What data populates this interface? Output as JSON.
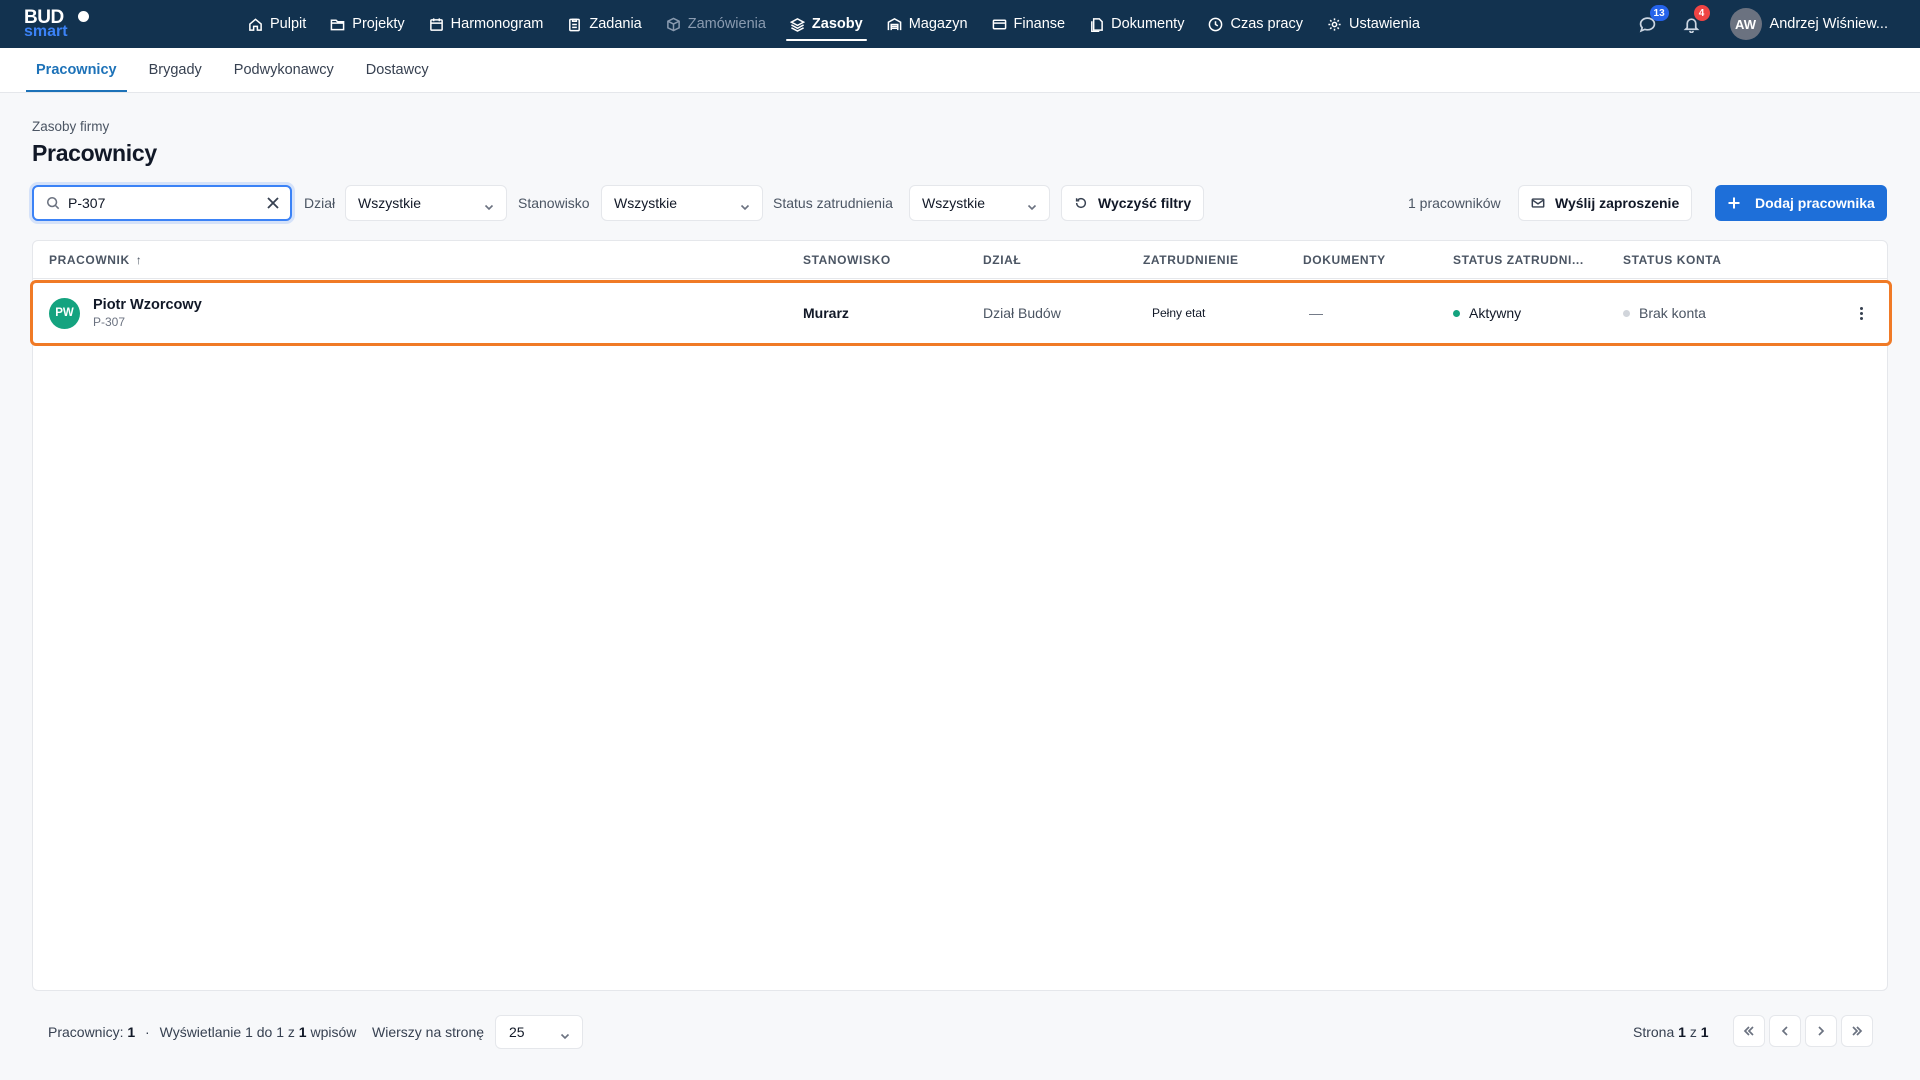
{
  "app": {
    "logo_top": "BUD",
    "logo_bottom": "smart"
  },
  "nav": {
    "items": [
      {
        "label": "Pulpit",
        "icon": "home-icon"
      },
      {
        "label": "Projekty",
        "icon": "folder-icon"
      },
      {
        "label": "Harmonogram",
        "icon": "calendar-icon"
      },
      {
        "label": "Zadania",
        "icon": "clipboard-icon"
      },
      {
        "label": "Zamówienia",
        "icon": "package-icon",
        "disabled": true
      },
      {
        "label": "Zasoby",
        "icon": "layers-icon",
        "active": true
      },
      {
        "label": "Magazyn",
        "icon": "warehouse-icon"
      },
      {
        "label": "Finanse",
        "icon": "card-icon"
      },
      {
        "label": "Dokumenty",
        "icon": "documents-icon"
      },
      {
        "label": "Czas pracy",
        "icon": "clock-icon"
      },
      {
        "label": "Ustawienia",
        "icon": "gear-icon"
      }
    ]
  },
  "topbar": {
    "messages_count": "13",
    "notifications_count": "4",
    "user_initials": "AW",
    "user_name": "Andrzej Wiśniew..."
  },
  "subnav": {
    "tabs": [
      "Pracownicy",
      "Brygady",
      "Podwykonawcy",
      "Dostawcy"
    ],
    "active": "Pracownicy"
  },
  "header": {
    "breadcrumb": "Zasoby firmy",
    "title": "Pracownicy"
  },
  "filters": {
    "search_value": "P-307",
    "dept_label": "Dział",
    "dept_value": "Wszystkie",
    "position_label": "Stanowisko",
    "position_value": "Wszystkie",
    "status_label": "Status zatrudnienia",
    "status_value": "Wszystkie",
    "clear_label": "Wyczyść filtry",
    "count_label": "1 pracowników",
    "invite_label": "Wyślij zaproszenie",
    "add_label": "Dodaj pracownika"
  },
  "table": {
    "columns": [
      "PRACOWNIK",
      "STANOWISKO",
      "DZIAŁ",
      "ZATRUDNIENIE",
      "DOKUMENTY",
      "STATUS ZATRUDNI...",
      "STATUS KONTA"
    ],
    "sort_indicator": "↑",
    "rows": [
      {
        "initials": "PW",
        "name": "Piotr Wzorcowy",
        "id": "P-307",
        "position": "Murarz",
        "department": "Dział Budów",
        "employment": "Pełny etat",
        "documents": "—",
        "employment_status": "Aktywny",
        "account_status": "Brak konta"
      }
    ]
  },
  "footer": {
    "employees_label": "Pracownicy:",
    "employees_count": "1",
    "separator": "·",
    "showing_prefix": "Wyświetlanie 1 do 1 z",
    "showing_total": "1",
    "showing_suffix": "wpisów",
    "rows_label": "Wierszy na stronę",
    "rows_value": "25",
    "page_prefix": "Strona",
    "page_current": "1",
    "page_of": "z",
    "page_total": "1"
  },
  "colors": {
    "topbar": "#12324f",
    "accent": "#1e6fd9",
    "highlight": "#f07a26",
    "avatar": "#14a37f",
    "active_dot": "#14a37f",
    "inactive_dot": "#d1d5db"
  }
}
